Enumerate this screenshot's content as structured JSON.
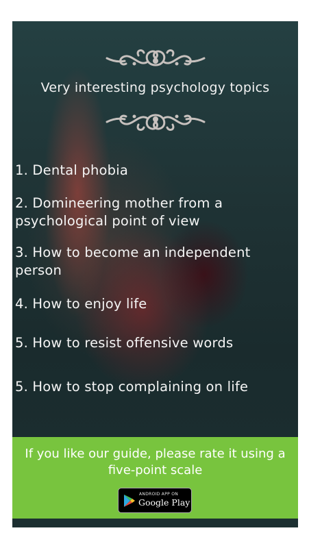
{
  "header": {
    "title": "Very interesting psychology topics"
  },
  "topics": [
    "1. Dental phobia",
    "2. Domineering mother from a psychological point of view",
    "3. How to become an independent person",
    "4. How to enjoy life",
    "5. How to resist offensive words",
    "5. How to stop complaining on life"
  ],
  "rate": {
    "message": "If you like our guide, please rate it using a five-point scale",
    "badge_small": "ANDROID APP ON",
    "badge_big": "Google Play"
  },
  "colors": {
    "panel_green": "#78c43e",
    "background_dark": "#1f3335",
    "ornament": "#c7c1be"
  },
  "icons": [
    "ornament-flourish-icon",
    "google-play-icon"
  ]
}
